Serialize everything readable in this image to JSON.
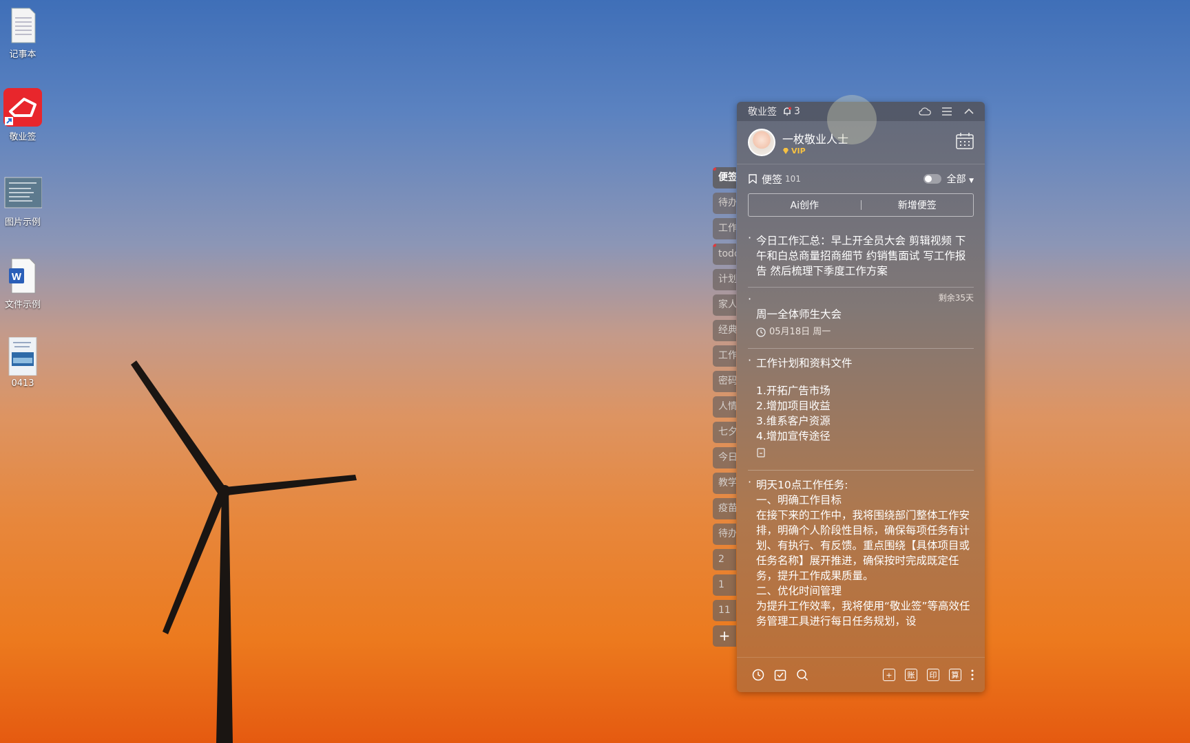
{
  "desktop": {
    "icons": [
      {
        "label": "记事本",
        "icon": "notepad-icon"
      },
      {
        "label": "敬业签",
        "icon": "jingyeqian-app-icon"
      },
      {
        "label": "图片示例",
        "icon": "image-thumbnail-icon"
      },
      {
        "label": "文件示例",
        "icon": "word-document-icon"
      },
      {
        "label": "0413",
        "icon": "presentation-thumbnail-icon"
      }
    ]
  },
  "tabs": [
    "便签",
    "待办",
    "工作",
    "todo",
    "计划",
    "家人",
    "经典",
    "工作",
    "密码",
    "人情",
    "七夕",
    "今日",
    "教学",
    "疫苗",
    "待办",
    "2",
    "1",
    "11",
    "+"
  ],
  "panel": {
    "app_name": "敬业签",
    "notify_count": "3",
    "user_name": "一枚敬业人士",
    "vip": "VIP",
    "notes_label": "便签",
    "notes_count": "101",
    "filter": "全部",
    "ai_button": "Ai创作",
    "new_button": "新增便签",
    "notes": [
      {
        "text": "今日工作汇总：早上开全员大会 剪辑视频 下午和白总商量招商细节 约销售面试 写工作报告 然后梳理下季度工作方案"
      },
      {
        "remaining": "剩余35天",
        "title": "周一全体师生大会",
        "date": "05月18日 周一"
      },
      {
        "title": "工作计划和资料文件",
        "lines": [
          "1.开拓广告市场",
          "2.增加项目收益",
          "3.维系客户资源",
          "4.增加宣传途径"
        ]
      },
      {
        "lines": [
          "明天10点工作任务:",
          "一、明确工作目标",
          "在接下来的工作中，我将围绕部门整体工作安排，明确个人阶段性目标，确保每项任务有计划、有执行、有反馈。重点围绕【具体项目或任务名称】展开推进，确保按时完成既定任务，提升工作成果质量。",
          "二、优化时间管理",
          "为提升工作效率，我将使用“敬业签”等高效任务管理工具进行每日任务规划，设"
        ]
      }
    ],
    "bottom_tools": {
      "account": "账",
      "print": "印",
      "calc": "算"
    }
  }
}
